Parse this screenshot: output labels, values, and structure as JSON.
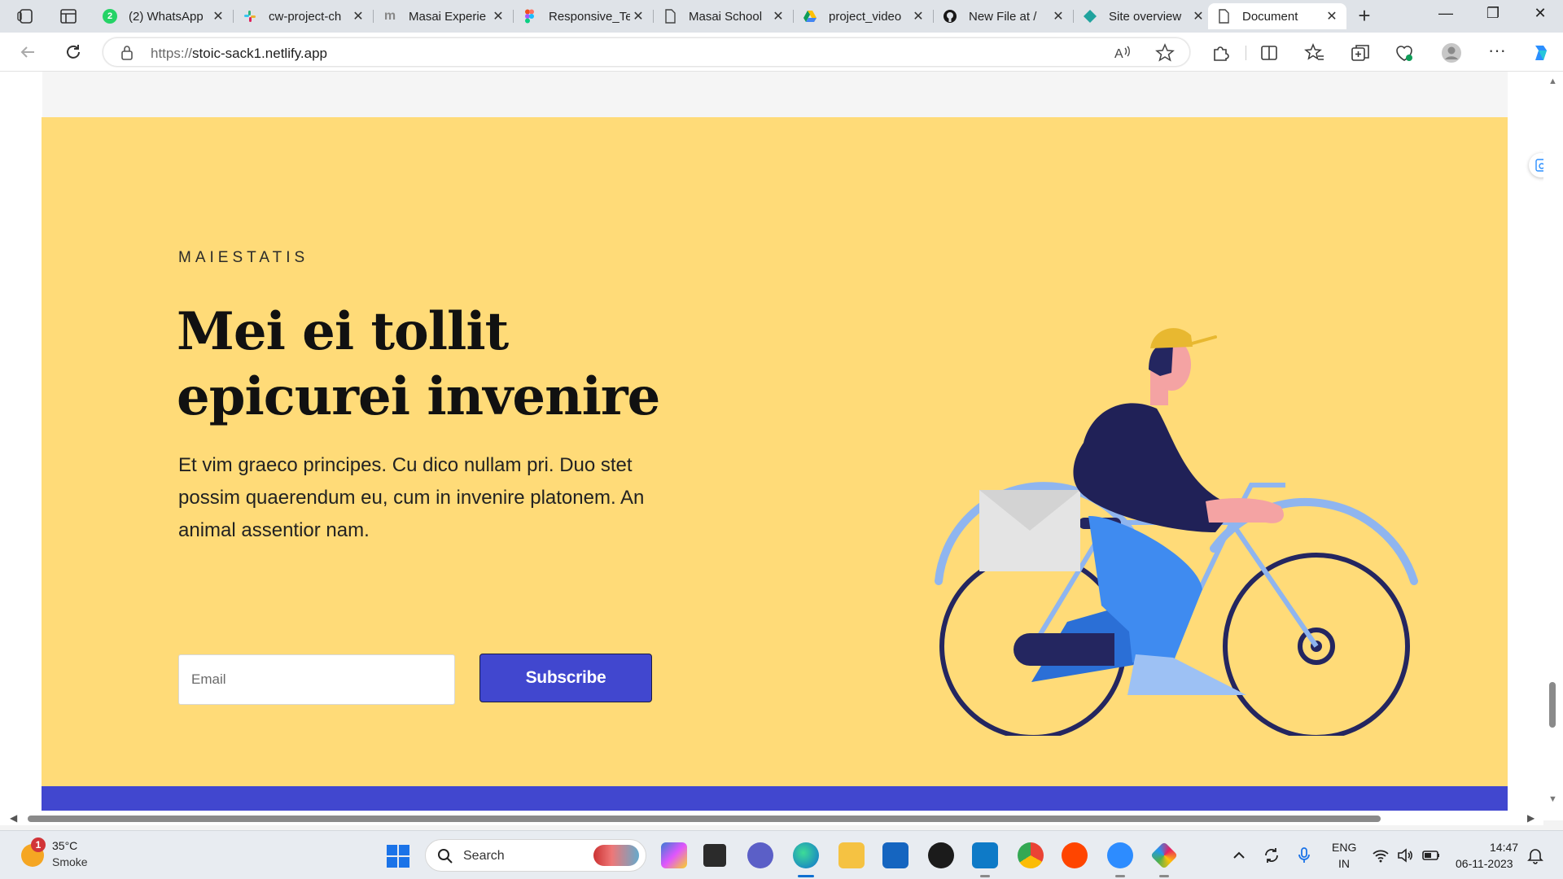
{
  "browser": {
    "tabs": [
      {
        "title": "(2) WhatsApp",
        "favicon": "whatsapp-icon",
        "color": "#25d366"
      },
      {
        "title": "cw-project-ch",
        "favicon": "slack-icon",
        "color": "#e01e5a"
      },
      {
        "title": "Masai Experie",
        "favicon": "masai-icon",
        "color": "#9aa0a6"
      },
      {
        "title": "Responsive_Te",
        "favicon": "figma-icon",
        "color": "#f24e1e"
      },
      {
        "title": "Masai School",
        "favicon": "document-icon",
        "color": "#5f6368"
      },
      {
        "title": "project_video",
        "favicon": "google-drive-icon",
        "color": "#4285f4"
      },
      {
        "title": "New File at /",
        "favicon": "github-icon",
        "color": "#181717"
      },
      {
        "title": "Site overview",
        "favicon": "netlify-icon",
        "color": "#20a39e"
      },
      {
        "title": "Document",
        "favicon": "document-icon",
        "color": "#5f6368"
      }
    ],
    "url_scheme": "https://",
    "url_host": "stoic-sack1.netlify.app"
  },
  "hero": {
    "eyebrow": "MAIESTATIS",
    "headline_line1": "Mei ei tollit",
    "headline_line2": "epicurei invenire",
    "body": "Et vim graeco principes. Cu dico nullam pri. Duo stet possim quaerendum eu, cum in invenire platonem. An animal assentior nam.",
    "email_placeholder": "Email",
    "subscribe_label": "Subscribe",
    "colors": {
      "background": "#ffdb78",
      "button": "#4147cf",
      "footer": "#4147cf"
    }
  },
  "taskbar": {
    "weather_temp": "35°C",
    "weather_desc": "Smoke",
    "weather_badge": "1",
    "search_label": "Search",
    "lang_line1": "ENG",
    "lang_line2": "IN",
    "time": "14:47",
    "date": "06-11-2023"
  }
}
